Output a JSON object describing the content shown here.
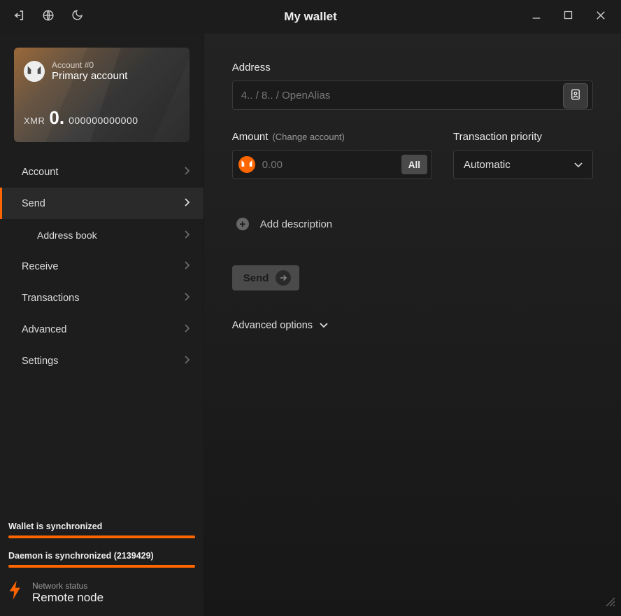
{
  "window": {
    "title": "My wallet"
  },
  "account_card": {
    "account_id": "Account #0",
    "account_name": "Primary account",
    "currency": "XMR",
    "balance_int": "0.",
    "balance_dec": "000000000000"
  },
  "nav": {
    "account": "Account",
    "send": "Send",
    "address_book": "Address book",
    "receive": "Receive",
    "transactions": "Transactions",
    "advanced": "Advanced",
    "settings": "Settings"
  },
  "sync": {
    "wallet": "Wallet is synchronized",
    "daemon": "Daemon is synchronized (2139429)"
  },
  "network": {
    "label": "Network status",
    "value": "Remote node"
  },
  "form": {
    "address_label": "Address",
    "address_placeholder": "4.. / 8.. / OpenAlias",
    "amount_label": "Amount",
    "amount_hint": "(Change account)",
    "amount_placeholder": "0.00",
    "all_btn": "All",
    "priority_label": "Transaction priority",
    "priority_value": "Automatic",
    "add_description": "Add description",
    "send_btn": "Send",
    "advanced_options": "Advanced options"
  }
}
